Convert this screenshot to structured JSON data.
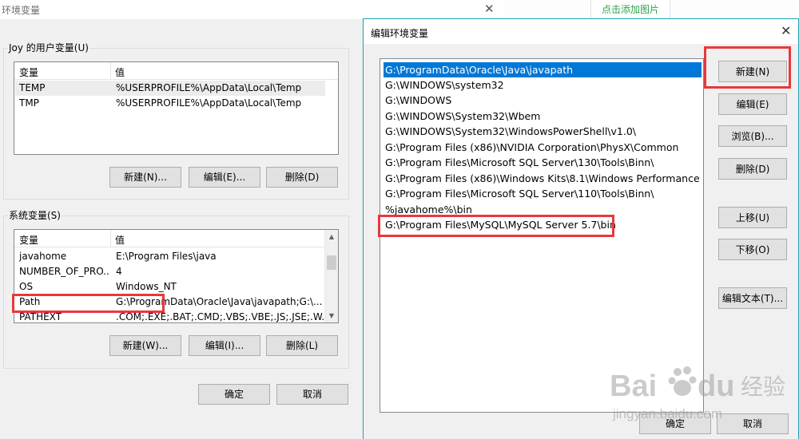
{
  "background_dialog": {
    "title": "环境变量",
    "user_vars": {
      "group_label": "Joy 的用户变量(U)",
      "col_var": "变量",
      "col_val": "值",
      "rows": [
        {
          "name": "TEMP",
          "value": "%USERPROFILE%\\AppData\\Local\\Temp"
        },
        {
          "name": "TMP",
          "value": "%USERPROFILE%\\AppData\\Local\\Temp"
        }
      ],
      "btn_new": "新建(N)...",
      "btn_edit": "编辑(E)...",
      "btn_delete": "删除(D)"
    },
    "system_vars": {
      "group_label": "系统变量(S)",
      "col_var": "变量",
      "col_val": "值",
      "rows": [
        {
          "name": "javahome",
          "value": "E:\\Program Files\\java"
        },
        {
          "name": "NUMBER_OF_PRO...",
          "value": "4"
        },
        {
          "name": "OS",
          "value": "Windows_NT"
        },
        {
          "name": "Path",
          "value": "G:\\ProgramData\\Oracle\\Java\\javapath;G:\\..."
        },
        {
          "name": "PATHEXT",
          "value": ".COM;.EXE;.BAT;.CMD;.VBS;.VBE;.JS;.JSE;.W..."
        }
      ],
      "btn_new": "新建(W)...",
      "btn_edit": "编辑(I)...",
      "btn_delete": "删除(L)"
    },
    "btn_ok": "确定",
    "btn_cancel": "取消"
  },
  "top_right": {
    "add_picture": "点击添加图片"
  },
  "edit_dialog": {
    "title": "编辑环境变量",
    "paths": [
      "G:\\ProgramData\\Oracle\\Java\\javapath",
      "G:\\WINDOWS\\system32",
      "G:\\WINDOWS",
      "G:\\WINDOWS\\System32\\Wbem",
      "G:\\WINDOWS\\System32\\WindowsPowerShell\\v1.0\\",
      "G:\\Program Files (x86)\\NVIDIA Corporation\\PhysX\\Common",
      "G:\\Program Files\\Microsoft SQL Server\\130\\Tools\\Binn\\",
      "G:\\Program Files (x86)\\Windows Kits\\8.1\\Windows Performance T...",
      "G:\\Program Files\\Microsoft SQL Server\\110\\Tools\\Binn\\",
      "%javahome%\\bin",
      "G:\\Program Files\\MySQL\\MySQL Server 5.7\\bin"
    ],
    "selected_index": 0,
    "btn_new": "新建(N)",
    "btn_edit": "编辑(E)",
    "btn_browse": "浏览(B)...",
    "btn_delete": "删除(D)",
    "btn_up": "上移(U)",
    "btn_down": "下移(O)",
    "btn_edit_text": "编辑文本(T)...",
    "btn_ok": "确定",
    "btn_cancel": "取消"
  },
  "watermark": {
    "brand": "Bai",
    "brand_cn": "经验",
    "url": "jingyan.baidu.com"
  },
  "colors": {
    "selection": "#0078d7",
    "highlight_box": "#e8383d",
    "dialog_border": "#1aa1b8",
    "add_picture_text": "#2fa54a"
  }
}
